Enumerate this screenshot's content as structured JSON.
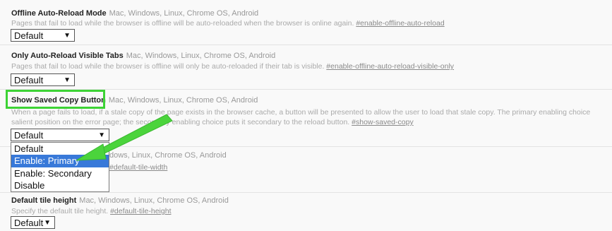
{
  "experiments": [
    {
      "title": "Offline Auto-Reload Mode",
      "platforms": "Mac, Windows, Linux, Chrome OS, Android",
      "description": "Pages that fail to load while the browser is offline will be auto-reloaded when the browser is online again. ",
      "flag": "#enable-offline-auto-reload",
      "value": "Default"
    },
    {
      "title": "Only Auto-Reload Visible Tabs",
      "platforms": "Mac, Windows, Linux, Chrome OS, Android",
      "description": "Pages that fail to load while the browser is offline will only be auto-reloaded if their tab is visible. ",
      "flag": "#enable-offline-auto-reload-visible-only",
      "value": "Default"
    },
    {
      "title": "Show Saved Copy Button",
      "platforms": "Mac, Windows, Linux, Chrome OS, Android",
      "description_line1": "When a page fails to load, if a stale copy of the page exists in the browser cache, a button will be presented to allow the user to load that stale copy. The primary enabling choice",
      "description_line2": "salient position on the error page; the secondary enabling choice puts it secondary to the reload button. ",
      "flag": "#show-saved-copy",
      "value": "Default",
      "options": [
        "Default",
        "Enable: Primary",
        "Enable: Secondary",
        "Disable"
      ],
      "highlighted_option": "Enable: Primary"
    },
    {
      "title_partial": "dows, Linux, Chrome OS, Android",
      "flag": "#default-tile-width"
    },
    {
      "title": "Default tile height",
      "platforms": "Mac, Windows, Linux, Chrome OS, Android",
      "description": "Specify the default tile height. ",
      "flag": "#default-tile-height",
      "value": "Default"
    }
  ],
  "colors": {
    "highlight_box": "#3dd335",
    "arrow": "#4bd43c",
    "selected_option": "#3879d9"
  },
  "icons": {
    "select_arrow": "▼"
  }
}
